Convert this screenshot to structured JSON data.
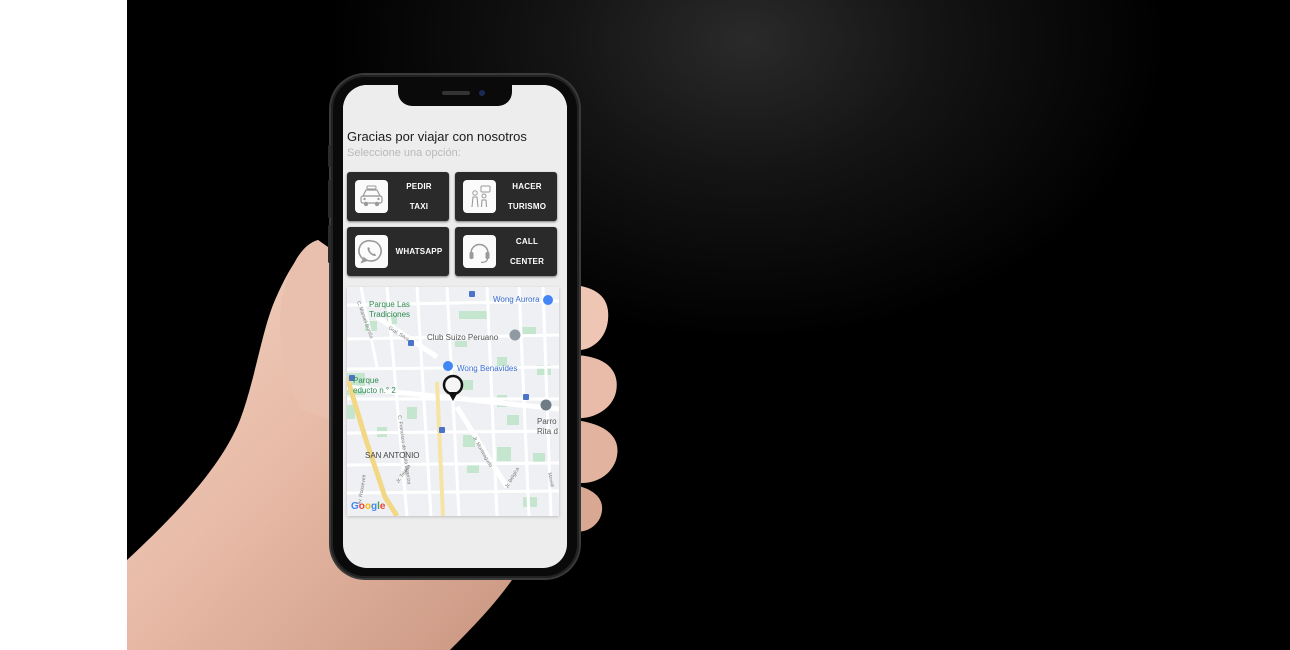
{
  "app": {
    "title": "Gracias por viajar con nosotros",
    "subtitle": "Seleccione una opción:"
  },
  "options": [
    {
      "icon": "taxi-icon",
      "line1": "PEDIR",
      "line2": "TAXI"
    },
    {
      "icon": "tourism-icon",
      "line1": "HACER",
      "line2": "TURISMO"
    },
    {
      "icon": "whatsapp-icon",
      "line1": "WHATSAPP",
      "line2": ""
    },
    {
      "icon": "headset-icon",
      "line1": "CALL",
      "line2": "CENTER"
    }
  ],
  "map": {
    "places": {
      "parque_tradiciones": "Parque Las\nTradiciones",
      "wong_aurora": "Wong Aurora",
      "club_suizo": "Club Suizo Peruano",
      "wong_benavides": "Wong Benavides",
      "parque_reducto": "Parque\neducto n.° 2",
      "parroquia": "Parro\nRita d",
      "san_antonio": "SAN ANTONIO"
    },
    "streets": {
      "francisco": "C. Francisco de Paula Ugarriza",
      "gral_silva": "Gral. Silva",
      "tejada": "Jr. Tejada",
      "monteagudo": "Jr. Monteagudo",
      "belgica": "Jr. Bélgica",
      "roosevelt": "Av. Roosevelt",
      "morelli": "Morelli",
      "manuel": "C. Manuel Bonilla"
    },
    "attribution": "Google",
    "accent_color": "#4285f4",
    "park_color": "#c4e6cf",
    "pin_icon": "location-pin-icon"
  }
}
